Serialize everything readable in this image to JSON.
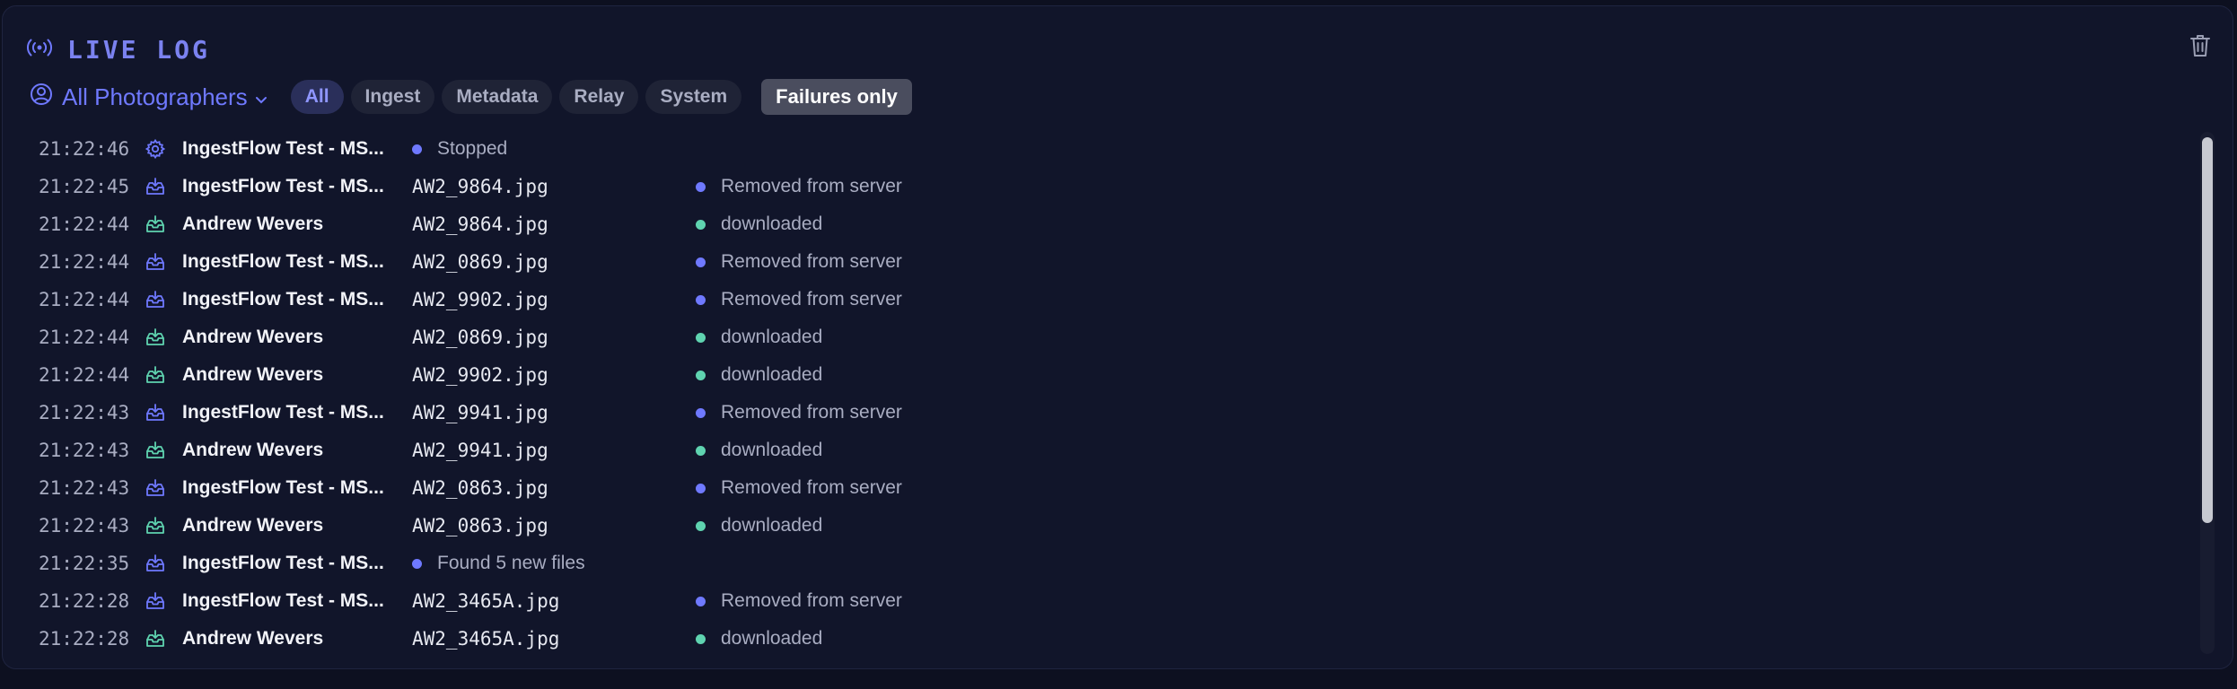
{
  "header": {
    "title": "LIVE LOG"
  },
  "toolbar": {
    "photographer_filter": "All Photographers",
    "tabs": [
      "All",
      "Ingest",
      "Metadata",
      "Relay",
      "System"
    ],
    "failures_only": "Failures only"
  },
  "colors": {
    "accent": "#6f79ff",
    "ingest_icon": "#6f79ff",
    "download_icon": "#5fd3b0",
    "dot_removed": "#6f79ff",
    "dot_downloaded": "#5fd3b0"
  },
  "log": [
    {
      "time": "21:22:46",
      "icon": "gear-icon",
      "source": "IngestFlow Test - MS...",
      "file": "",
      "status": "Stopped",
      "kind": "system"
    },
    {
      "time": "21:22:45",
      "icon": "inbox-icon",
      "source": "IngestFlow Test - MS...",
      "file": "AW2_9864.jpg",
      "status": "Removed from server",
      "kind": "removed"
    },
    {
      "time": "21:22:44",
      "icon": "inbox-download-icon",
      "source": "Andrew Wevers",
      "file": "AW2_9864.jpg",
      "status": "downloaded",
      "kind": "downloaded"
    },
    {
      "time": "21:22:44",
      "icon": "inbox-icon",
      "source": "IngestFlow Test - MS...",
      "file": "AW2_0869.jpg",
      "status": "Removed from server",
      "kind": "removed"
    },
    {
      "time": "21:22:44",
      "icon": "inbox-icon",
      "source": "IngestFlow Test - MS...",
      "file": "AW2_9902.jpg",
      "status": "Removed from server",
      "kind": "removed"
    },
    {
      "time": "21:22:44",
      "icon": "inbox-download-icon",
      "source": "Andrew Wevers",
      "file": "AW2_0869.jpg",
      "status": "downloaded",
      "kind": "downloaded"
    },
    {
      "time": "21:22:44",
      "icon": "inbox-download-icon",
      "source": "Andrew Wevers",
      "file": "AW2_9902.jpg",
      "status": "downloaded",
      "kind": "downloaded"
    },
    {
      "time": "21:22:43",
      "icon": "inbox-icon",
      "source": "IngestFlow Test - MS...",
      "file": "AW2_9941.jpg",
      "status": "Removed from server",
      "kind": "removed"
    },
    {
      "time": "21:22:43",
      "icon": "inbox-download-icon",
      "source": "Andrew Wevers",
      "file": "AW2_9941.jpg",
      "status": "downloaded",
      "kind": "downloaded"
    },
    {
      "time": "21:22:43",
      "icon": "inbox-icon",
      "source": "IngestFlow Test - MS...",
      "file": "AW2_0863.jpg",
      "status": "Removed from server",
      "kind": "removed"
    },
    {
      "time": "21:22:43",
      "icon": "inbox-download-icon",
      "source": "Andrew Wevers",
      "file": "AW2_0863.jpg",
      "status": "downloaded",
      "kind": "downloaded"
    },
    {
      "time": "21:22:35",
      "icon": "inbox-icon",
      "source": "IngestFlow Test - MS...",
      "file": "",
      "status": "Found 5 new files",
      "kind": "system"
    },
    {
      "time": "21:22:28",
      "icon": "inbox-icon",
      "source": "IngestFlow Test - MS...",
      "file": "AW2_3465A.jpg",
      "status": "Removed from server",
      "kind": "removed"
    },
    {
      "time": "21:22:28",
      "icon": "inbox-download-icon",
      "source": "Andrew Wevers",
      "file": "AW2_3465A.jpg",
      "status": "downloaded",
      "kind": "downloaded"
    }
  ]
}
